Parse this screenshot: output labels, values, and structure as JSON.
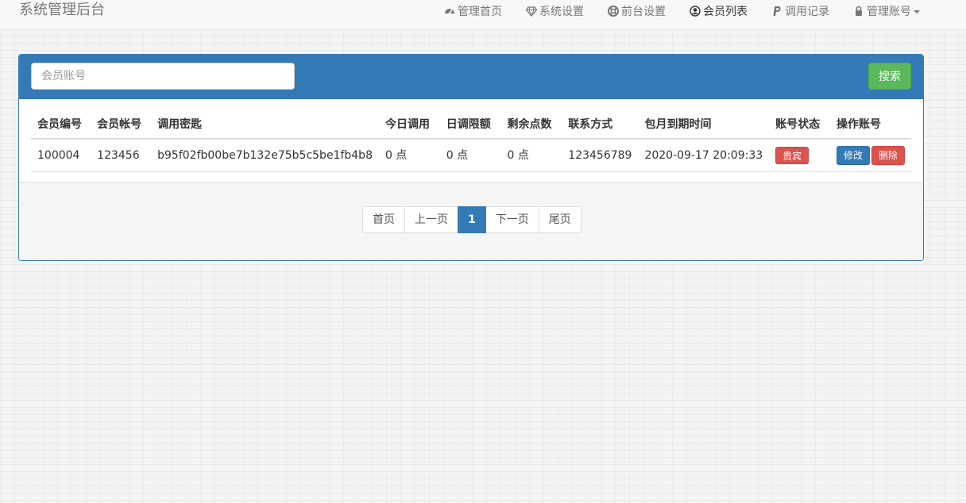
{
  "navbar": {
    "brand": "系统管理后台",
    "items": [
      {
        "label": "管理首页",
        "icon": "dashboard-icon"
      },
      {
        "label": "系统设置",
        "icon": "diamond-icon"
      },
      {
        "label": "前台设置",
        "icon": "lifebuoy-icon"
      },
      {
        "label": "会员列表",
        "icon": "user-circle-icon",
        "active": true
      },
      {
        "label": "调用记录",
        "icon": "paypal-icon"
      },
      {
        "label": "管理账号",
        "icon": "lock-icon",
        "dropdown": true
      }
    ]
  },
  "search": {
    "placeholder": "会员账号",
    "value": "",
    "button_label": "搜索"
  },
  "table": {
    "headers": [
      "会员编号",
      "会员帐号",
      "调用密匙",
      "今日调用",
      "日调限额",
      "剩余点数",
      "联系方式",
      "包月到期时间",
      "账号状态",
      "操作账号"
    ],
    "rows": [
      {
        "id": "100004",
        "account": "123456",
        "key": "b95f02fb00be7b132e75b5c5be1fb4b8",
        "today_calls": "0 点",
        "daily_limit": "0 点",
        "remaining": "0 点",
        "contact": "123456789",
        "expiry": "2020-09-17 20:09:33",
        "status": "贵宾",
        "edit_label": "修改",
        "delete_label": "删除"
      }
    ]
  },
  "pagination": {
    "first": "首页",
    "prev": "上一页",
    "current": "1",
    "next": "下一页",
    "last": "尾页"
  },
  "colors": {
    "primary": "#337ab7",
    "success": "#5cb85c",
    "danger": "#d9534f"
  }
}
